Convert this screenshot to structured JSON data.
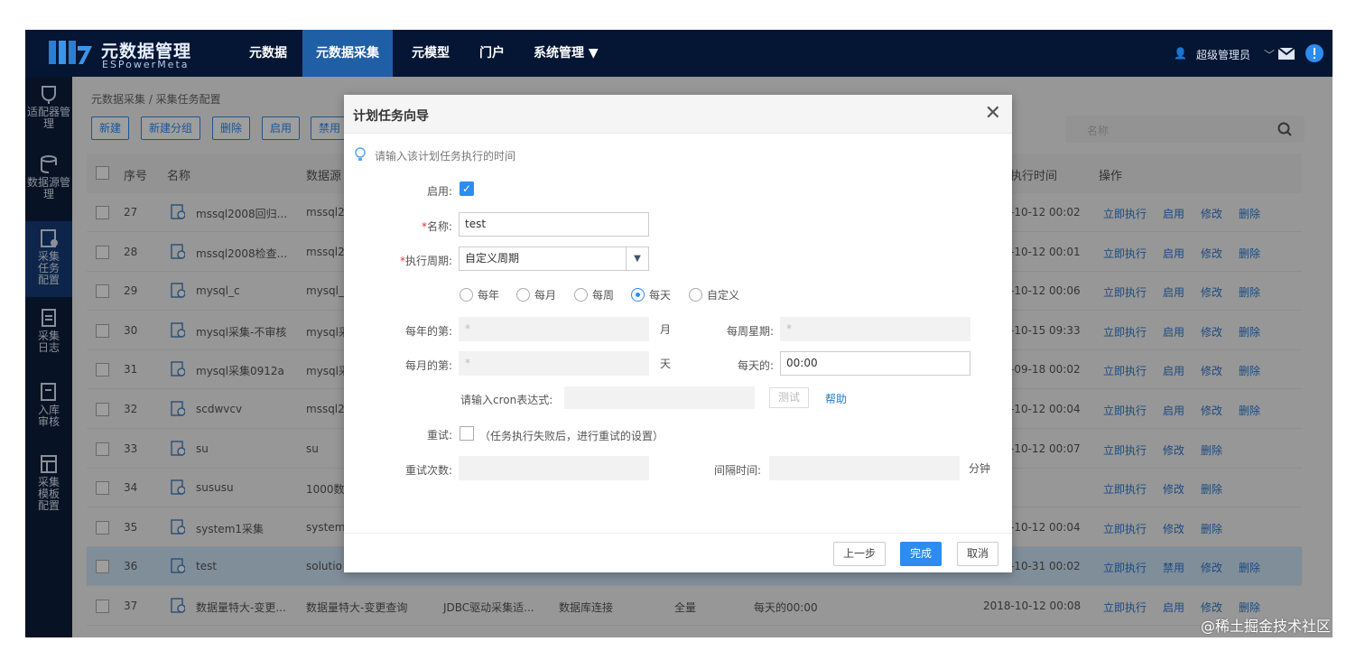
{
  "header": {
    "brand": "元数据管理",
    "brand_sub": "ESPowerMeta",
    "nav": [
      "元数据",
      "元数据采集",
      "元模型",
      "门户",
      "系统管理 ▼"
    ],
    "user": "超级管理员"
  },
  "sidebar": [
    "适配器管理",
    "数据源管理",
    "采集任务配置",
    "采集日志",
    "入库审核",
    "采集模板配置"
  ],
  "breadcrumb": "元数据采集  /  采集任务配置",
  "toolbar": [
    "新建",
    "新建分组",
    "删除",
    "启用",
    "禁用"
  ],
  "search_placeholder": "名称",
  "table": {
    "headers": {
      "seq": "序号",
      "name": "名称",
      "source": "数据源",
      "exec_time": "执行时间",
      "ops": "操作"
    },
    "rows": [
      {
        "seq": "27",
        "name": "mssql2008回归...",
        "source": "mssql2",
        "time": "-10-12 00:02",
        "actions": [
          "立即执行",
          "启用",
          "修改",
          "删除"
        ]
      },
      {
        "seq": "28",
        "name": "mssql2008检查...",
        "source": "mssql2",
        "time": "-10-12 00:01",
        "actions": [
          "立即执行",
          "启用",
          "修改",
          "删除"
        ]
      },
      {
        "seq": "29",
        "name": "mysql_c",
        "source": "mysql_",
        "time": "-10-12 00:06",
        "actions": [
          "立即执行",
          "启用",
          "修改",
          "删除"
        ]
      },
      {
        "seq": "30",
        "name": "mysql采集-不审核",
        "source": "mysql采",
        "time": "-10-15 09:33",
        "actions": [
          "立即执行",
          "启用",
          "修改",
          "删除"
        ]
      },
      {
        "seq": "31",
        "name": "mysql采集0912a",
        "source": "mysql采",
        "time": "-09-18 00:02",
        "actions": [
          "立即执行",
          "启用",
          "修改",
          "删除"
        ]
      },
      {
        "seq": "32",
        "name": "scdwvcv",
        "source": "mssql2",
        "time": "-10-12 00:04",
        "actions": [
          "立即执行",
          "启用",
          "修改",
          "删除"
        ]
      },
      {
        "seq": "33",
        "name": "su",
        "source": "su",
        "time": "-10-12 00:07",
        "actions": [
          "立即执行",
          "修改",
          "删除"
        ]
      },
      {
        "seq": "34",
        "name": "sususu",
        "source": "1000数",
        "time": "",
        "actions": [
          "立即执行",
          "修改",
          "删除"
        ]
      },
      {
        "seq": "35",
        "name": "system1采集",
        "source": "system",
        "time": "-10-12 00:04",
        "actions": [
          "立即执行",
          "修改",
          "删除"
        ]
      },
      {
        "seq": "36",
        "name": "test",
        "source": "solutio",
        "time": "-10-31 00:02",
        "actions": [
          "立即执行",
          "禁用",
          "修改",
          "删除"
        ],
        "selected": true
      },
      {
        "seq": "37",
        "name": "数据量特大-变更...",
        "source": "数据量特大-变更查询",
        "adapter": "JDBC驱动采集适...",
        "conn": "数据库连接",
        "mode": "全量",
        "schedule": "每天的00:00",
        "time": "2018-10-12 00:08",
        "actions": [
          "立即执行",
          "启用",
          "修改",
          "删除"
        ]
      }
    ]
  },
  "dialog": {
    "title": "计划任务向导",
    "hint": "请输入该计划任务执行的时间",
    "enable_label": "启用:",
    "name_label": "名称:",
    "name_value": "test",
    "period_label": "执行周期:",
    "period_value": "自定义周期",
    "radios": [
      "每年",
      "每月",
      "每周",
      "每天",
      "自定义"
    ],
    "radio_selected": "每天",
    "year_label": "每年的第:",
    "year_value": "*",
    "month_unit": "月",
    "week_label": "每周星期:",
    "week_value": "*",
    "month_label": "每月的第:",
    "month_value": "*",
    "day_unit": "天",
    "daily_label": "每天的:",
    "daily_value": "00:00",
    "cron_label": "请输入cron表达式:",
    "cron_value": "",
    "test_btn": "测试",
    "help_link": "帮助",
    "retry_label": "重试:",
    "retry_note": "（任务执行失败后，进行重试的设置）",
    "retry_count_label": "重试次数:",
    "interval_label": "间隔时间:",
    "interval_unit": "分钟",
    "buttons": {
      "prev": "上一步",
      "finish": "完成",
      "cancel": "取消"
    }
  },
  "watermark": "@稀土掘金技术社区",
  "colors": {
    "header": "#041634",
    "accent": "#2d8cf0"
  }
}
